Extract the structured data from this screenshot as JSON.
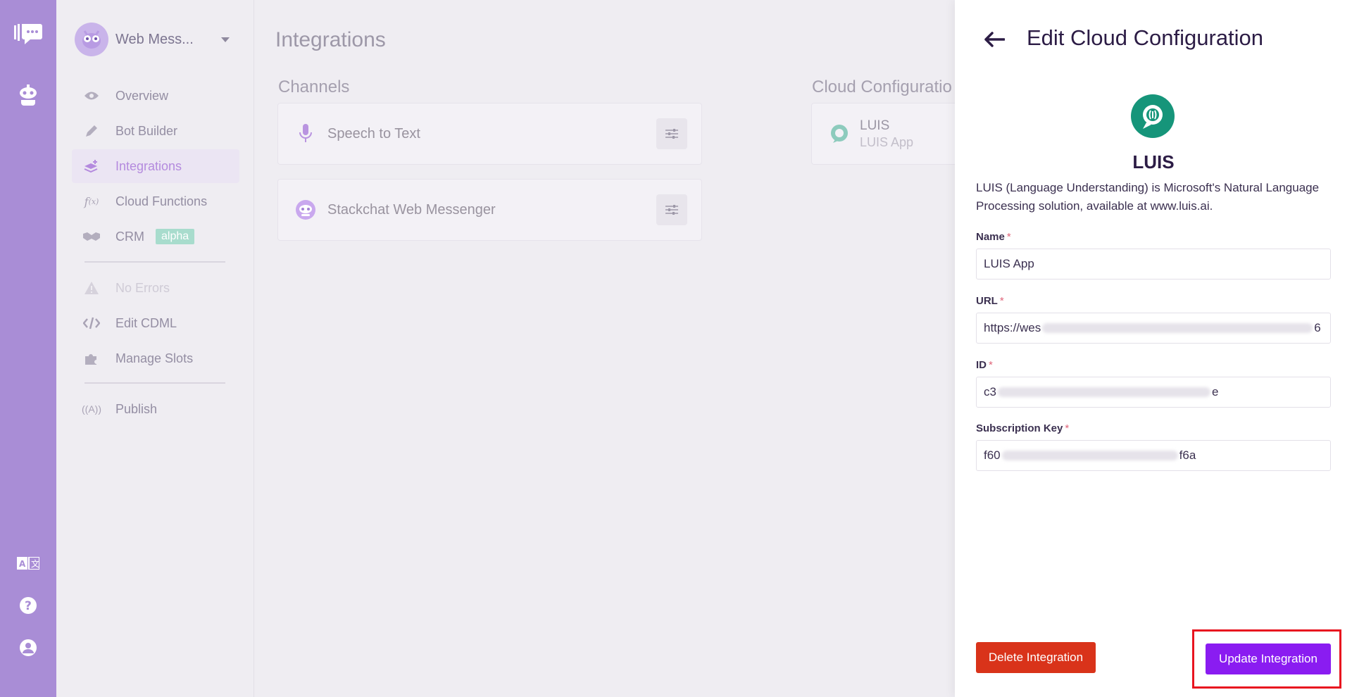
{
  "rail": {
    "icons": [
      "chat-logo-icon",
      "bot-icon",
      "translate-icon",
      "help-icon",
      "account-icon"
    ]
  },
  "sidebar": {
    "bot_name": "Web Mess...",
    "items": [
      {
        "label": "Overview",
        "icon": "eye-icon"
      },
      {
        "label": "Bot Builder",
        "icon": "pencil-icon"
      },
      {
        "label": "Integrations",
        "icon": "layers-plus-icon"
      },
      {
        "label": "Cloud Functions",
        "icon": "function-icon"
      },
      {
        "label": "CRM",
        "icon": "handshake-icon",
        "badge": "alpha"
      },
      {
        "label": "No Errors",
        "icon": "warning-icon"
      },
      {
        "label": "Edit CDML",
        "icon": "code-icon"
      },
      {
        "label": "Manage Slots",
        "icon": "puzzle-icon"
      },
      {
        "label": "Publish",
        "icon": "broadcast-icon"
      }
    ]
  },
  "main": {
    "title": "Integrations",
    "channels_title": "Channels",
    "channels": [
      {
        "label": "Speech to Text",
        "icon": "microphone-icon"
      },
      {
        "label": "Stackchat Web Messenger",
        "icon": "robot-icon"
      }
    ],
    "cloud_title": "Cloud Configuratio",
    "cloud_card": {
      "title": "LUIS",
      "subtitle": "LUIS App"
    }
  },
  "panel": {
    "title": "Edit Cloud Configuration",
    "logo_title": "LUIS",
    "description": "LUIS (Language Understanding) is Microsoft's Natural Language Processing solution, available at www.luis.ai.",
    "fields": {
      "name": {
        "label": "Name",
        "value": "LUIS App"
      },
      "url": {
        "label": "URL",
        "prefix": "https://wes",
        "suffix": "6"
      },
      "id": {
        "label": "ID",
        "prefix": "c3",
        "suffix": "e"
      },
      "key": {
        "label": "Subscription Key",
        "prefix": "f60",
        "suffix": "f6a"
      }
    },
    "required_mark": "*",
    "delete_label": "Delete Integration",
    "update_label": "Update Integration"
  },
  "colors": {
    "accent": "#8a1cf1",
    "danger": "#d9331a",
    "rail": "#a98dd6",
    "luis_logo": "#16957a"
  }
}
